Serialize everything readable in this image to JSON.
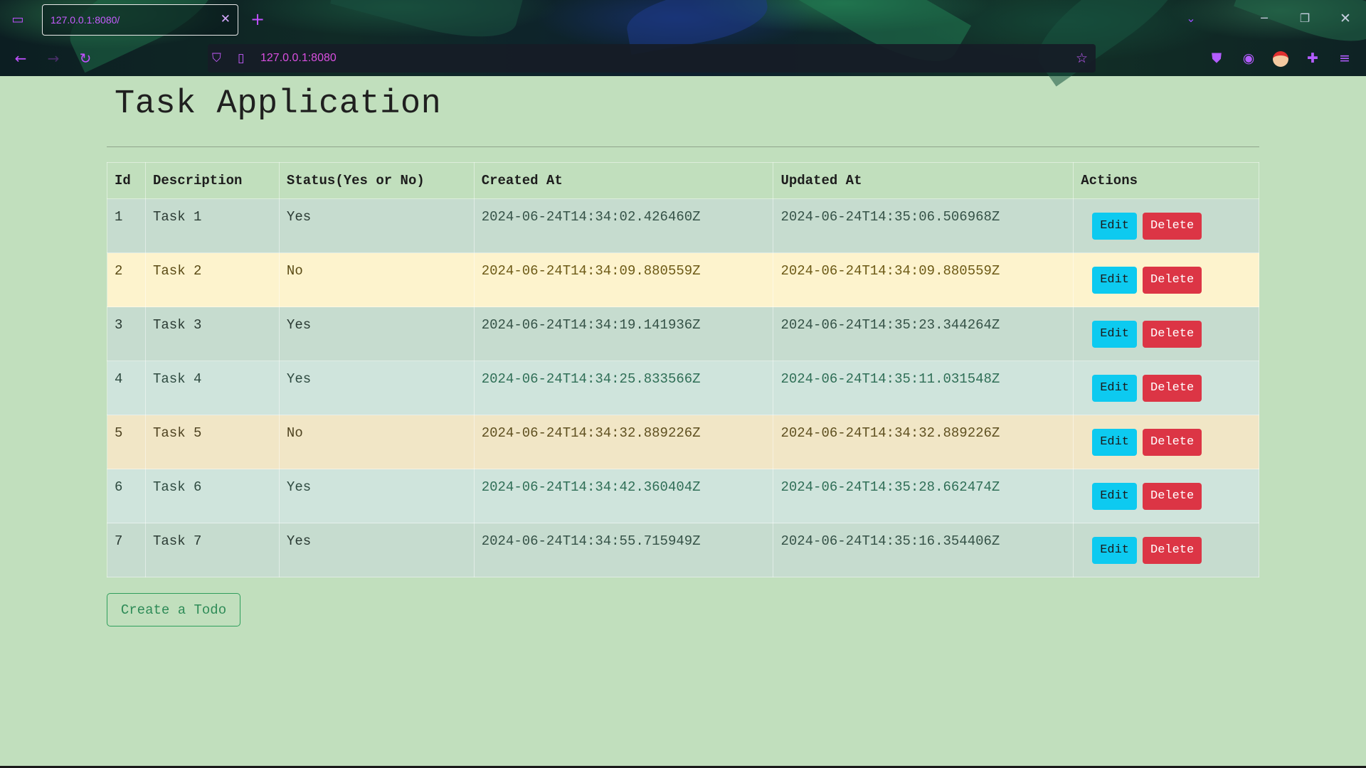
{
  "browser": {
    "tab_title": "127.0.0.1:8080/",
    "url": "127.0.0.1:8080",
    "icons": {
      "tab_list": "tab-list-icon",
      "close_tab": "close-icon",
      "new_tab": "plus-icon",
      "back": "back-arrow-icon",
      "forward": "forward-arrow-icon",
      "reload": "reload-icon",
      "tracking_protection": "shield-icon",
      "page_info": "page-icon",
      "bookmark": "star-icon",
      "pocket": "pocket-icon",
      "account": "account-icon",
      "extension_avatar": "extension-avatar-icon",
      "extensions": "puzzle-icon",
      "menu": "hamburger-menu-icon",
      "tab_overflow": "chevron-down-icon",
      "minimize": "minimize-icon",
      "restore": "restore-icon",
      "close_window": "close-window-icon"
    },
    "accent_color": "#c050ff"
  },
  "page": {
    "title": "Task Application",
    "table": {
      "headers": [
        "Id",
        "Description",
        "Status(Yes or No)",
        "Created At",
        "Updated At",
        "Actions"
      ],
      "rows": [
        {
          "id": "1",
          "description": "Task 1",
          "status": "Yes",
          "created_at": "2024-06-24T14:34:02.426460Z",
          "updated_at": "2024-06-24T14:35:06.506968Z",
          "edit": "Edit",
          "delete": "Delete"
        },
        {
          "id": "2",
          "description": "Task 2",
          "status": "No",
          "created_at": "2024-06-24T14:34:09.880559Z",
          "updated_at": "2024-06-24T14:34:09.880559Z",
          "edit": "Edit",
          "delete": "Delete"
        },
        {
          "id": "3",
          "description": "Task 3",
          "status": "Yes",
          "created_at": "2024-06-24T14:34:19.141936Z",
          "updated_at": "2024-06-24T14:35:23.344264Z",
          "edit": "Edit",
          "delete": "Delete"
        },
        {
          "id": "4",
          "description": "Task 4",
          "status": "Yes",
          "created_at": "2024-06-24T14:34:25.833566Z",
          "updated_at": "2024-06-24T14:35:11.031548Z",
          "edit": "Edit",
          "delete": "Delete"
        },
        {
          "id": "5",
          "description": "Task 5",
          "status": "No",
          "created_at": "2024-06-24T14:34:32.889226Z",
          "updated_at": "2024-06-24T14:34:32.889226Z",
          "edit": "Edit",
          "delete": "Delete"
        },
        {
          "id": "6",
          "description": "Task 6",
          "status": "Yes",
          "created_at": "2024-06-24T14:34:42.360404Z",
          "updated_at": "2024-06-24T14:35:28.662474Z",
          "edit": "Edit",
          "delete": "Delete"
        },
        {
          "id": "7",
          "description": "Task 7",
          "status": "Yes",
          "created_at": "2024-06-24T14:34:55.715949Z",
          "updated_at": "2024-06-24T14:35:16.354406Z",
          "edit": "Edit",
          "delete": "Delete"
        }
      ]
    },
    "create_button": "Create a Todo",
    "colors": {
      "background": "#c1dfbd",
      "edit_button": "#0dcaf0",
      "delete_button": "#dc3545",
      "create_button_border": "#2f9e5c"
    }
  }
}
